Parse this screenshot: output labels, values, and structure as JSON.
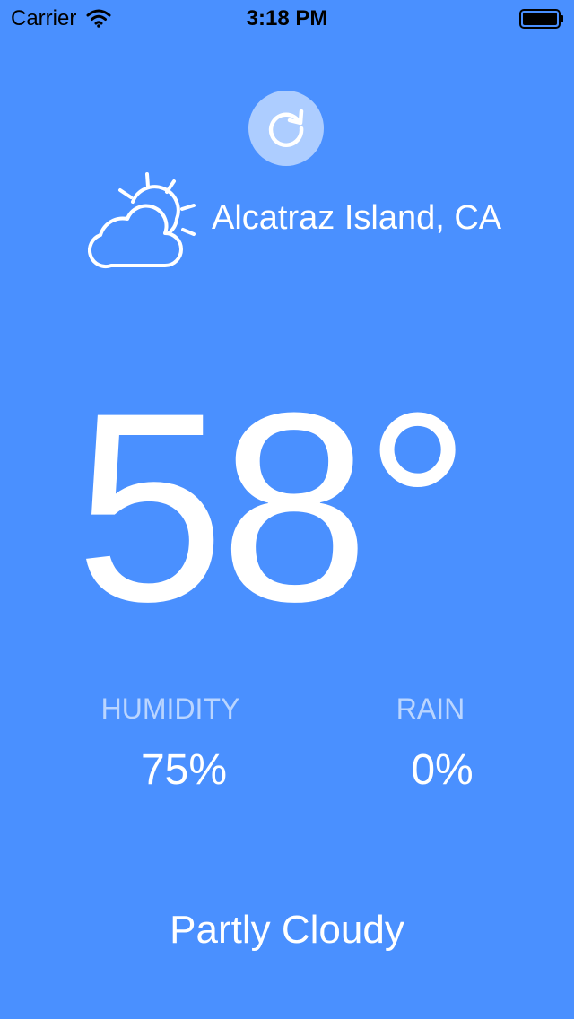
{
  "status_bar": {
    "carrier": "Carrier",
    "time": "3:18 PM",
    "wifi_icon": "wifi-icon",
    "battery_icon": "battery-icon"
  },
  "refresh": {
    "icon": "refresh-icon"
  },
  "weather": {
    "icon": "partly-cloudy-icon",
    "location": "Alcatraz Island, CA",
    "temperature": "58°",
    "humidity_label": "HUMIDITY",
    "humidity_value": "75%",
    "rain_label": "RAIN",
    "rain_value": "0%",
    "condition": "Partly Cloudy"
  },
  "colors": {
    "background": "#4a90ff",
    "text": "#ffffff"
  }
}
